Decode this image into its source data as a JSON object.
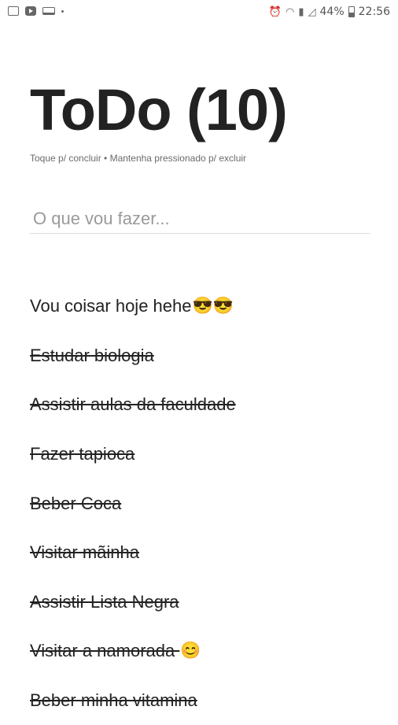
{
  "status_bar": {
    "battery": "44%",
    "time": "22:56",
    "icons": [
      "image-icon",
      "youtube-icon",
      "laptop-icon",
      "dot-icon",
      "alarm-icon",
      "wifi-icon",
      "sim-icon",
      "signal-icon",
      "battery-icon"
    ]
  },
  "app": {
    "title": "ToDo (10)",
    "subtitle": "Toque p/ concluir • Mantenha pressionado p/ excluir",
    "input_placeholder": "O que vou fazer..."
  },
  "todos": [
    {
      "text": "Vou coisar hoje hehe",
      "emoji": "😎😎",
      "done": false
    },
    {
      "text": "Estudar biologia",
      "emoji": "",
      "done": true
    },
    {
      "text": "Assistir aulas da faculdade",
      "emoji": "",
      "done": true
    },
    {
      "text": "Fazer tapioca",
      "emoji": "",
      "done": true
    },
    {
      "text": "Beber Coca",
      "emoji": "",
      "done": true
    },
    {
      "text": "Visitar mãinha",
      "emoji": "",
      "done": true
    },
    {
      "text": "Assistir Lista Negra",
      "emoji": "",
      "done": true
    },
    {
      "text": "Visitar a namorada ",
      "emoji": "😊",
      "done": true
    },
    {
      "text": "Beber minha vitamina",
      "emoji": "",
      "done": true
    }
  ]
}
